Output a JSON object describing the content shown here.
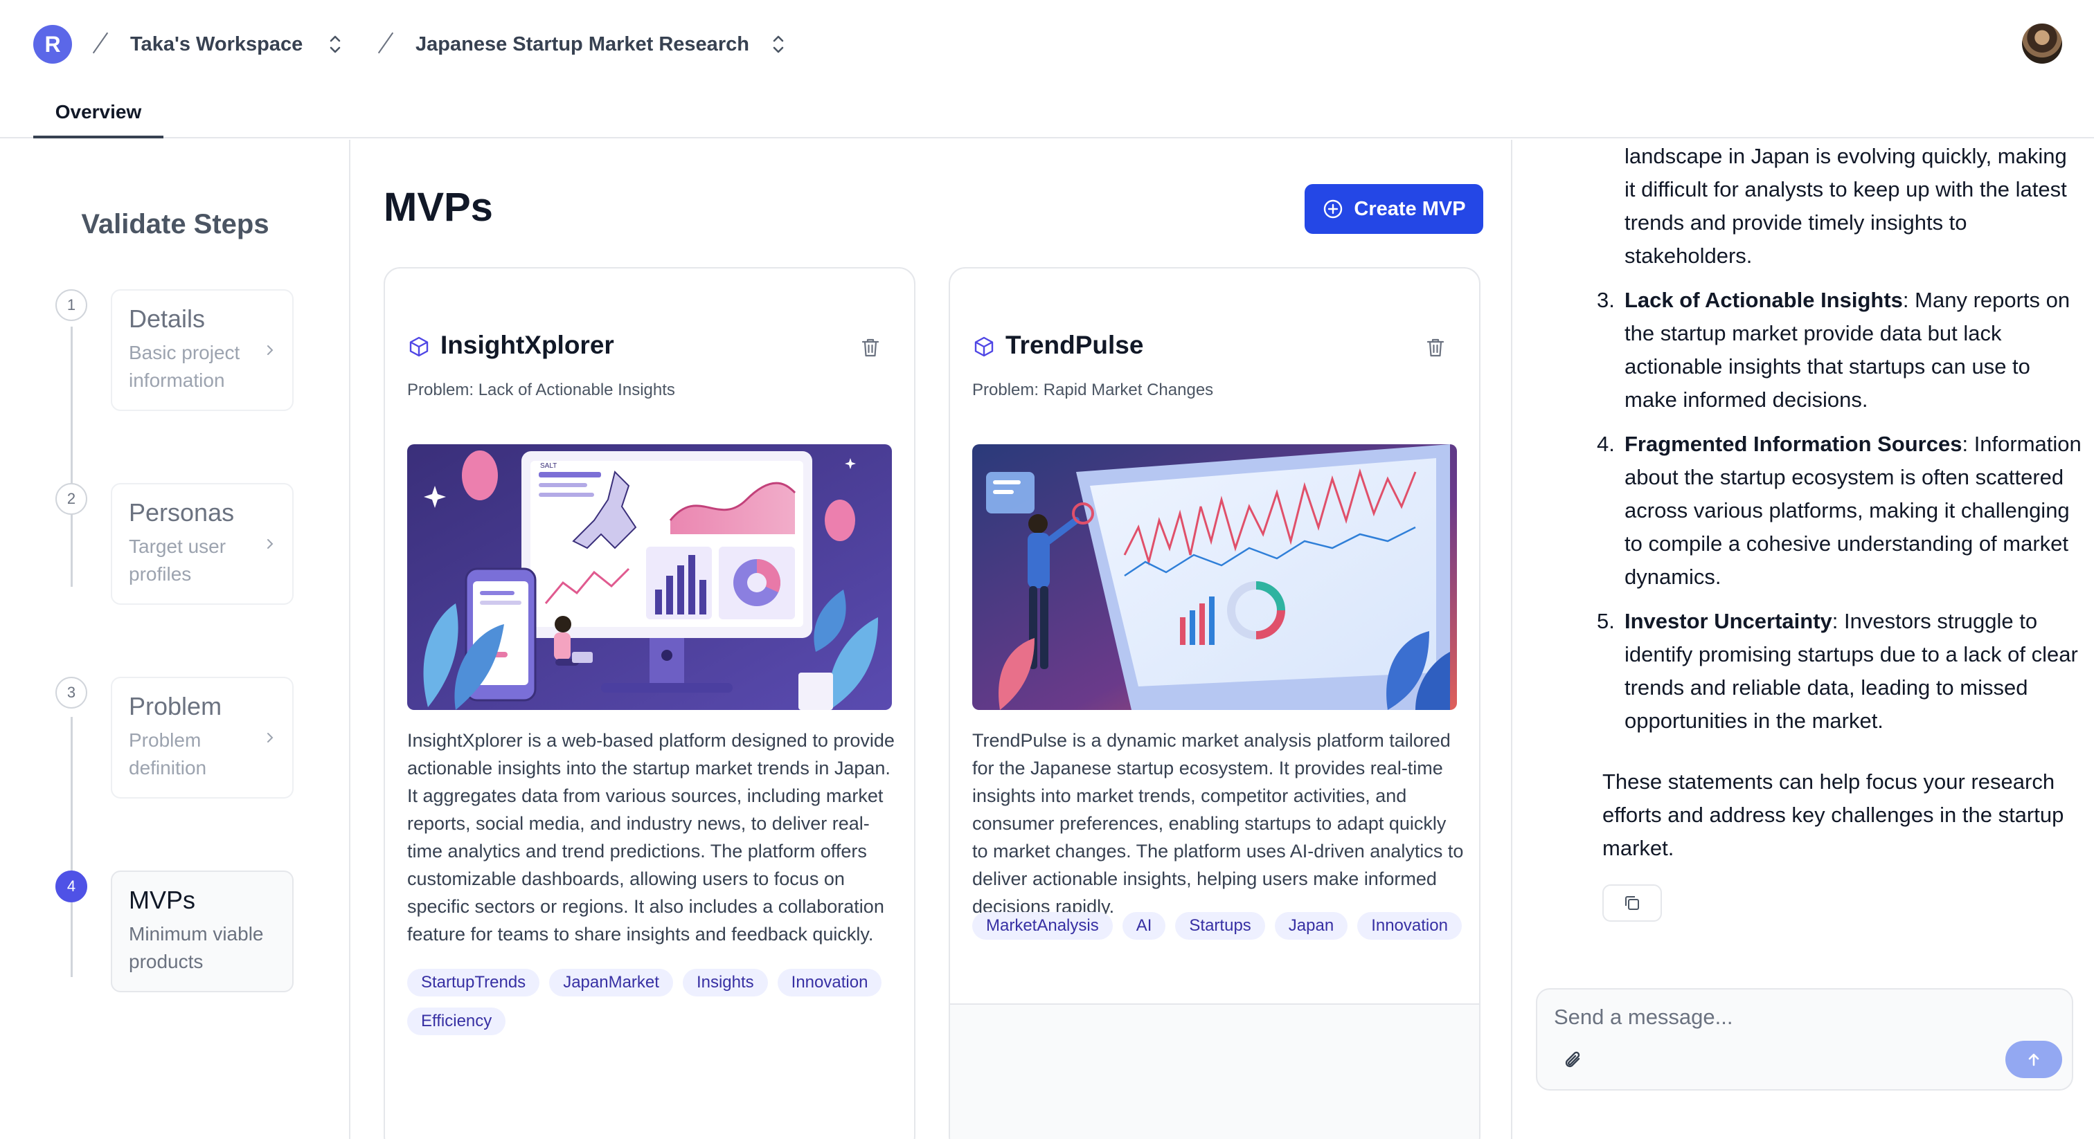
{
  "header": {
    "workspace_initial": "R",
    "workspace_name": "Taka's Workspace",
    "project_name": "Japanese Startup Market Research"
  },
  "tabs": [
    {
      "label": "Overview",
      "active": true
    }
  ],
  "steps": {
    "title": "Validate Steps",
    "items": [
      {
        "number": "1",
        "title": "Details",
        "description": "Basic project information",
        "active": false
      },
      {
        "number": "2",
        "title": "Personas",
        "description": "Target user profiles",
        "active": false
      },
      {
        "number": "3",
        "title": "Problem",
        "description": "Problem definition",
        "active": false
      },
      {
        "number": "4",
        "title": "MVPs",
        "description": "Minimum viable products",
        "active": true
      }
    ]
  },
  "main": {
    "title": "MVPs",
    "create_button": "Create MVP",
    "accent_color": "#2447e6"
  },
  "mvps": [
    {
      "name": "InsightXplorer",
      "problem": "Problem: Lack of Actionable Insights",
      "description": "InsightXplorer is a web-based platform designed to provide actionable insights into the startup market trends in Japan. It aggregates data from various sources, including market reports, social media, and industry news, to deliver real-time analytics and trend predictions. The platform offers customizable dashboards, allowing users to focus on specific sectors or regions. It also includes a collaboration feature for teams to share insights and feedback quickly.",
      "tags": [
        "StartupTrends",
        "JapanMarket",
        "Insights",
        "Innovation",
        "Efficiency"
      ],
      "image_label": "SALT"
    },
    {
      "name": "TrendPulse",
      "problem": "Problem: Rapid Market Changes",
      "description": "TrendPulse is a dynamic market analysis platform tailored for the Japanese startup ecosystem. It provides real-time insights into market trends, competitor activities, and consumer preferences, enabling startups to adapt quickly to market changes. The platform uses AI-driven analytics to deliver actionable insights, helping users make informed decisions rapidly.",
      "tags": [
        "MarketAnalysis",
        "AI",
        "Startups",
        "Japan",
        "Innovation"
      ],
      "image_label": ""
    }
  ],
  "chat": {
    "intro_tail": "landscape in Japan is evolving quickly, making it difficult for analysts to keep up with the latest trends and provide timely insights to stakeholders.",
    "items": [
      {
        "num": "3.",
        "bold": "Lack of Actionable Insights",
        "text": ": Many reports on the startup market provide data but lack actionable insights that startups can use to make informed decisions."
      },
      {
        "num": "4.",
        "bold": "Fragmented Information Sources",
        "text": ": Information about the startup ecosystem is often scattered across various platforms, making it challenging to compile a cohesive understanding of market dynamics."
      },
      {
        "num": "5.",
        "bold": "Investor Uncertainty",
        "text": ": Investors struggle to identify promising startups due to a lack of clear trends and reliable data, leading to missed opportunities in the market."
      }
    ],
    "closing": "These statements can help focus your research efforts and address key challenges in the startup market.",
    "input_placeholder": "Send a message..."
  }
}
